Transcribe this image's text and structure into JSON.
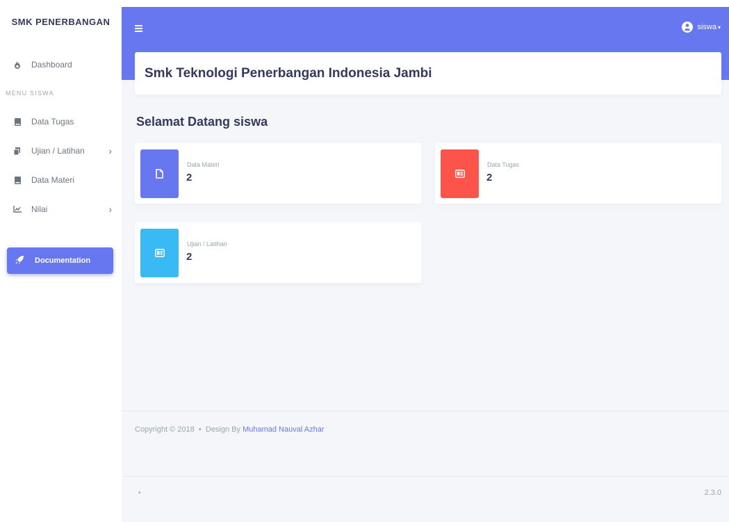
{
  "brand": "SMK PENERBANGAN",
  "sidebar": {
    "dashboard": "Dashboard",
    "header": "MENU SISWA",
    "items": [
      {
        "label": "Data Tugas",
        "icon": "book-icon"
      },
      {
        "label": "Ujian / Latihan",
        "icon": "copy-icon"
      },
      {
        "label": "Data Materi",
        "icon": "book-icon"
      },
      {
        "label": "Nilai",
        "icon": "chart-icon"
      }
    ],
    "documentation": "Documentation"
  },
  "topbar": {
    "user": "siswa"
  },
  "page": {
    "title": "Smk Teknologi Penerbangan Indonesia Jambi",
    "welcome": "Selamat Datang siswa"
  },
  "stats": [
    {
      "label": "Data Materi",
      "value": "2",
      "color": "#6777ef",
      "icon": "file-icon"
    },
    {
      "label": "Data Tugas",
      "value": "2",
      "color": "#fc544b",
      "icon": "newspaper-icon"
    },
    {
      "label": "Ujian / Latihan",
      "value": "2",
      "color": "#3abaf4",
      "icon": "newspaper-icon"
    }
  ],
  "footer": {
    "copyright": "Copyright © 2018",
    "bullet": "•",
    "design_by": "Design By",
    "author": "Muhamad Nauval Azhar",
    "bottom_bullet": "•",
    "version": "2.3.0"
  }
}
